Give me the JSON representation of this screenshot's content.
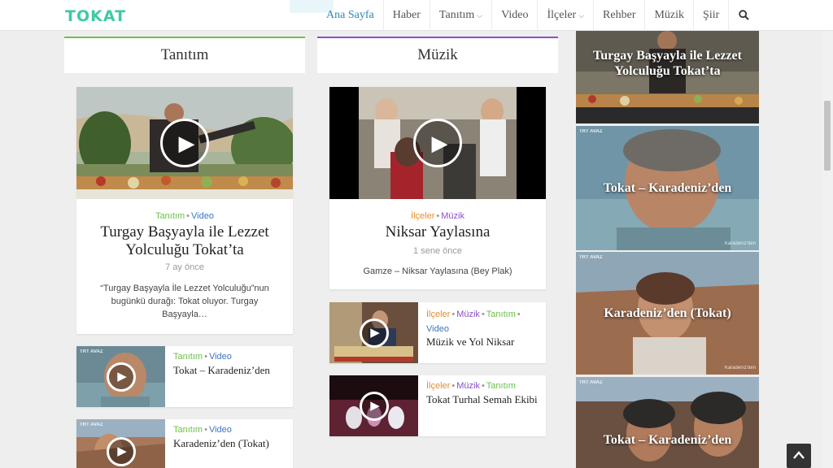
{
  "site": {
    "logo": "TOKAT"
  },
  "nav": {
    "items": [
      {
        "label": "Ana Sayfa",
        "dropdown": false,
        "active": true
      },
      {
        "label": "Haber",
        "dropdown": false
      },
      {
        "label": "Tanıtım",
        "dropdown": true
      },
      {
        "label": "Video",
        "dropdown": false
      },
      {
        "label": "İlçeler",
        "dropdown": true
      },
      {
        "label": "Rehber",
        "dropdown": false
      },
      {
        "label": "Müzik",
        "dropdown": false
      },
      {
        "label": "Şiir",
        "dropdown": false
      }
    ],
    "search_icon": "search-icon"
  },
  "columns": {
    "tanitim": {
      "heading": "Tanıtım",
      "accent": "#6cc04a",
      "featured": {
        "cat1": "Tanıtım",
        "cat2": "Video",
        "title": "Turgay Başyayla ile Lezzet Yolculuğu Tokat’ta",
        "date": "7 ay önce",
        "excerpt": "“Turgay Başyayla İle Lezzet Yolculuğu”nun bugünkü durağı: Tokat oluyor. Turgay Başyayla…"
      },
      "list": [
        {
          "cat1": "Tanıtım",
          "cat2": "Video",
          "title": "Tokat – Karadeniz’den"
        },
        {
          "cat1": "Tanıtım",
          "cat2": "Video",
          "title": "Karadeniz’den (Tokat)"
        }
      ]
    },
    "muzik": {
      "heading": "Müzik",
      "accent": "#8a4fc9",
      "featured": {
        "cat1": "İlçeler",
        "cat2": "Müzik",
        "title": "Niksar Yaylasına",
        "date": "1 sene önce",
        "excerpt": "Gamze – Niksar Yaylasına (Bey Plak)"
      },
      "list": [
        {
          "cat1": "İlçeler",
          "cat2": "Müzik",
          "cat3": "Tanıtım",
          "cat4": "Video",
          "title": "Müzik ve Yol Niksar"
        },
        {
          "cat1": "İlçeler",
          "cat2": "Müzik",
          "cat3": "Tanıtım",
          "title": "Tokat Turhal Semah Ekibi"
        }
      ]
    }
  },
  "sidebar": {
    "items": [
      {
        "title": "Turgay Başyayla ile Lezzet Yolculuğu Tokat’ta"
      },
      {
        "title": "Tokat – Karadeniz’den",
        "brand": "TRT AVAZ",
        "watermark": "Karadeniz'den"
      },
      {
        "title": "Karadeniz’den (Tokat)",
        "brand": "TRT AVAZ",
        "watermark": "Karadeniz'den"
      },
      {
        "title": "Tokat – Karadeniz’den",
        "brand": "TRT AVAZ"
      }
    ]
  },
  "back_to_top_icon": "chevron-up-icon"
}
